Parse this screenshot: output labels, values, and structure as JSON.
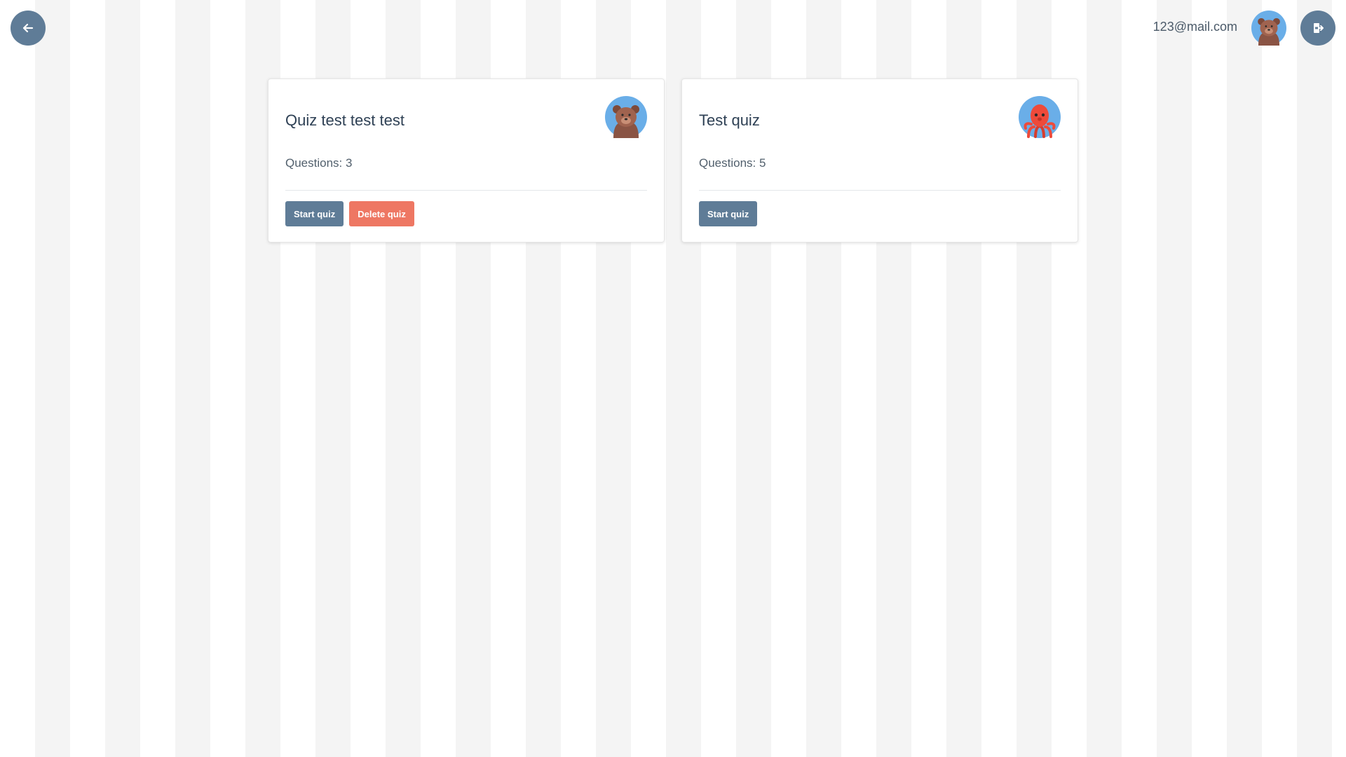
{
  "header": {
    "back_icon": "arrow-left-icon",
    "user_email": "123@mail.com",
    "user_avatar": "bear-avatar",
    "logout_icon": "logout-icon"
  },
  "quizzes": [
    {
      "title": "Quiz test test test",
      "questions_text": "Questions: 3",
      "avatar": "bear-avatar",
      "start_label": "Start quiz",
      "delete_label": "Delete quiz"
    },
    {
      "title": "Test quiz",
      "questions_text": "Questions: 5",
      "avatar": "octopus-avatar",
      "start_label": "Start quiz"
    }
  ],
  "colors": {
    "primary": "#5f7c97",
    "danger": "#ee7763",
    "avatar_background": "#6aaee8",
    "bear": "#9c5f4c",
    "octopus": "#ee4a3a"
  }
}
